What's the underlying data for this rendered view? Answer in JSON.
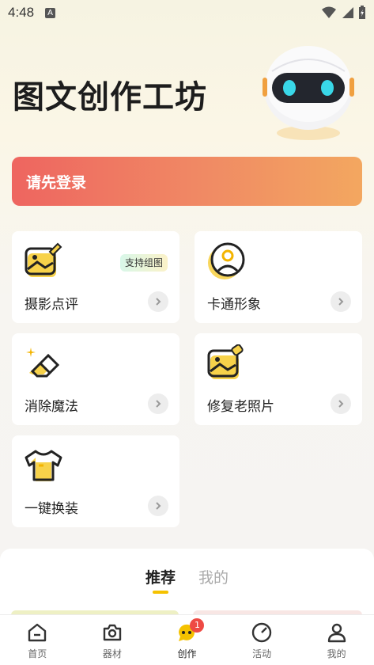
{
  "status_bar": {
    "time": "4:48",
    "indicator": "A"
  },
  "header": {
    "title": "图文创作工坊"
  },
  "login_banner": {
    "label": "请先登录"
  },
  "features": [
    {
      "label": "摄影点评",
      "tag": "支持组图",
      "icon": "photo-edit-icon"
    },
    {
      "label": "卡通形象",
      "icon": "avatar-icon"
    },
    {
      "label": "消除魔法",
      "icon": "eraser-icon"
    },
    {
      "label": "修复老照片",
      "icon": "photo-repair-icon"
    },
    {
      "label": "一键换装",
      "icon": "tshirt-icon"
    }
  ],
  "feed_tabs": {
    "recommend": "推荐",
    "mine": "我的"
  },
  "bottom_nav": [
    {
      "label": "首页",
      "icon": "home-icon"
    },
    {
      "label": "器材",
      "icon": "camera-icon"
    },
    {
      "label": "创作",
      "icon": "chat-icon",
      "badge": "1",
      "active": true
    },
    {
      "label": "活动",
      "icon": "gauge-icon"
    },
    {
      "label": "我的",
      "icon": "person-icon"
    }
  ],
  "colors": {
    "accent": "#f5c200",
    "banner_start": "#ee6560",
    "banner_end": "#f3a760",
    "badge": "#ee4a44"
  }
}
